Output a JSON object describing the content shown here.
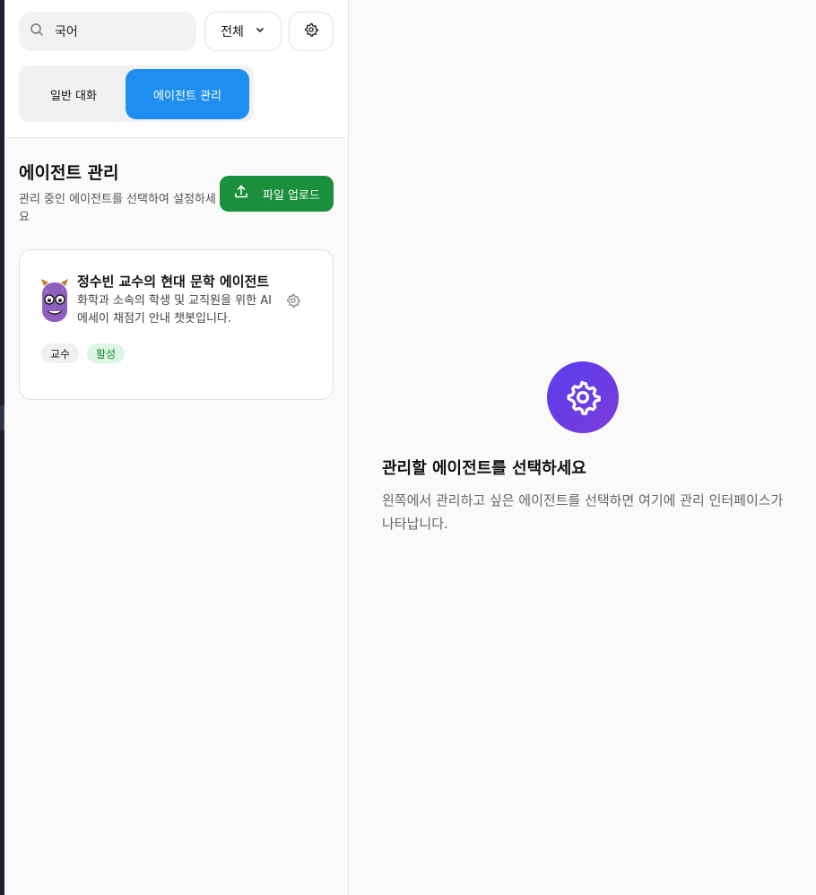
{
  "search": {
    "value": "국어",
    "icon": "search-icon"
  },
  "filter": {
    "selected": "전체",
    "icon": "chevron-down-icon"
  },
  "settings": {
    "icon": "gear-icon"
  },
  "tabs": [
    {
      "label": "일반 대화",
      "active": false
    },
    {
      "label": "에이전트 관리",
      "active": true
    }
  ],
  "section": {
    "title": "에이전트 관리",
    "subtitle": "관리 중인 에이전트를 선택하여 설정하세요",
    "upload_label": "파일 업로드",
    "upload_icon": "upload-icon"
  },
  "agent_card": {
    "title": "정수빈 교수의 현대 문학 에이전트",
    "description": "화학과 소속의 학생 및 교직원을 위한 AI 에세이 채점기 안내 챗봇입니다.",
    "role_badge": "교수",
    "status_badge": "활성",
    "avatar_icon": "monster-avatar-icon",
    "settings_icon": "gear-icon"
  },
  "empty_state": {
    "icon": "gear-icon",
    "title": "관리할 에이전트를 선택하세요",
    "description": "왼쪽에서 관리하고 싶은 에이전트를 선택하면 여기에 관리 인터페이스가 나타납니다."
  },
  "colors": {
    "accent_blue": "#1e8ef0",
    "upload_green": "#1a8f3c",
    "status_green_bg": "#dcf6e3",
    "status_green_text": "#1b8a3a",
    "purple_gradient_start": "#5a3ef0",
    "purple_gradient_end": "#7b3bd9"
  }
}
